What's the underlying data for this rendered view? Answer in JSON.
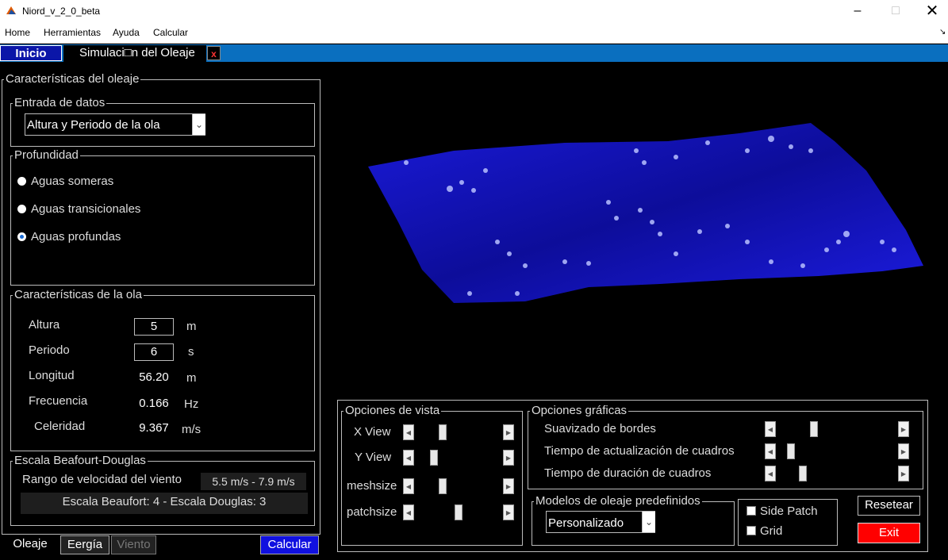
{
  "window": {
    "title": "Niord_v_2_0_beta"
  },
  "menu": [
    "Home",
    "Herramientas",
    "Ayuda",
    "Calcular"
  ],
  "tabs": {
    "inicio": "Inicio",
    "simulacion": "Simulaci□n del Oleaje",
    "close": "x"
  },
  "wave_panel": {
    "title": "Características del oleaje",
    "data_entry": {
      "title": "Entrada de datos",
      "selected": "Altura y Periodo de la ola"
    },
    "depth": {
      "title": "Profundidad",
      "options": [
        "Aguas someras",
        "Aguas transicionales",
        "Aguas profundas"
      ],
      "selected": "Aguas profundas"
    },
    "wave_chars": {
      "title": "Características de la ola",
      "rows": [
        {
          "label": "Altura",
          "value": "5",
          "unit": "m"
        },
        {
          "label": "Periodo",
          "value": "6",
          "unit": "s"
        },
        {
          "label": "Longitud",
          "value": "56.20",
          "unit": "m"
        },
        {
          "label": "Frecuencia",
          "value": "0.166",
          "unit": "Hz"
        },
        {
          "label": "Celeridad",
          "value": "9.367",
          "unit": "m/s"
        }
      ]
    },
    "beaufort": {
      "title": "Escala Beafourt-Douglas",
      "range_label": "Rango de velocidad del viento",
      "range_value": "5.5 m/s - 7.9 m/s",
      "scale_text": "Escala Beaufort: 4 - Escala Douglas: 3"
    }
  },
  "bottom_tabs": {
    "oleaje": "Oleaje",
    "energia": "Eergía",
    "viento": "Viento",
    "calcular": "Calcular"
  },
  "view_options": {
    "title": "Opciones de vista",
    "sliders": [
      {
        "label": "X View",
        "value": 0.3
      },
      {
        "label": "Y View",
        "value": 0.2
      },
      {
        "label": "meshsize",
        "value": 0.3
      },
      {
        "label": "patchsize",
        "value": 0.5
      }
    ]
  },
  "graphic_options": {
    "title": "Opciones gráficas",
    "sliders": [
      {
        "label": "Suavizado de bordes",
        "value": 0.3
      },
      {
        "label": "Tiempo de actualización de cuadros",
        "value": 0.1
      },
      {
        "label": "Tiempo de duración de cuadros",
        "value": 0.2
      }
    ]
  },
  "models": {
    "title": "Modelos de oleaje predefinidos",
    "selected": "Personalizado"
  },
  "checks": {
    "side_patch": "Side Patch",
    "grid": "Grid"
  },
  "buttons": {
    "reset": "Resetear",
    "exit": "Exit"
  },
  "colors": {
    "accent_blue": "#0a6fbf",
    "tab_blue": "#0b16a8",
    "exit_red": "#ff0000",
    "surface_blue": "#1a1ad0"
  }
}
